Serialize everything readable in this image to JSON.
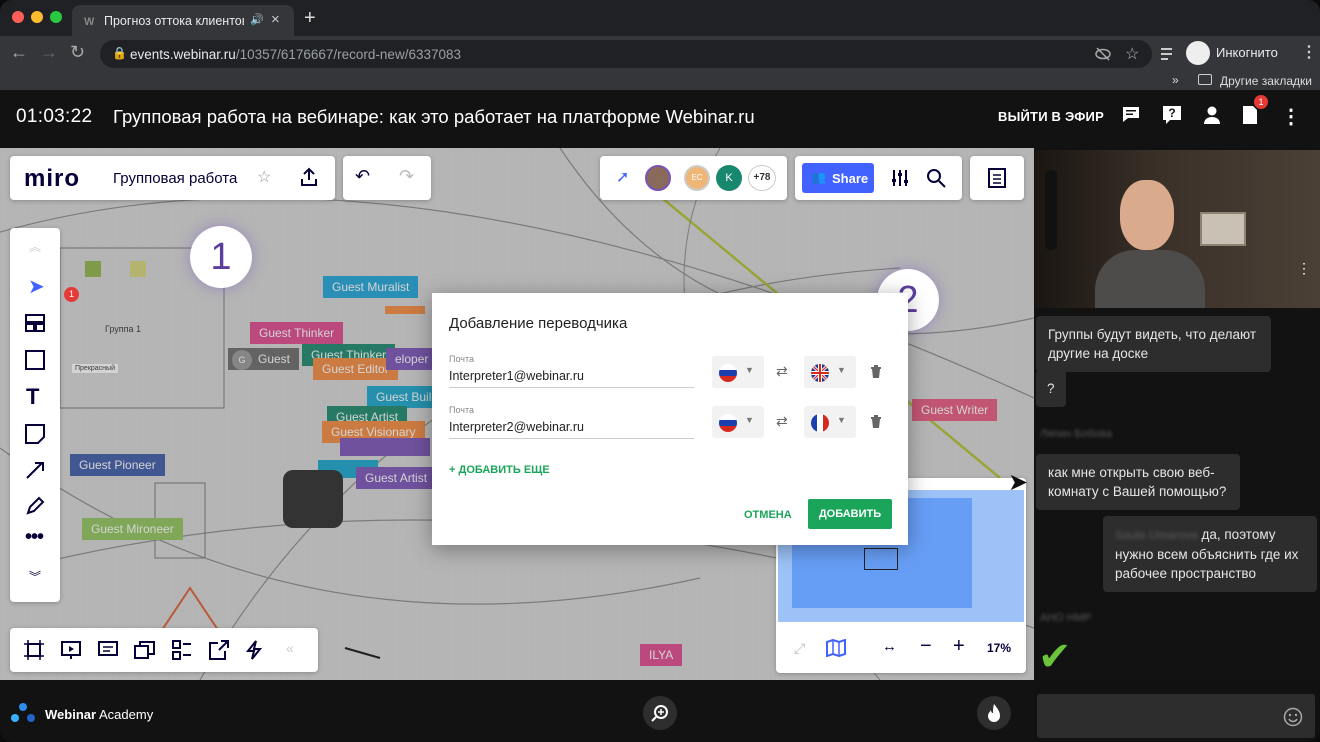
{
  "browser": {
    "tab_title": "Прогноз оттока клиентов",
    "tab_favicon": "W",
    "url_host": "events.webinar.ru",
    "url_path": "/10357/6176667/record-new/6337083",
    "profile_label": "Инкогнито",
    "bookmarks_label": "Другие закладки",
    "bookmarks_more": "»"
  },
  "header": {
    "timer": "01:03:22",
    "title": "Групповая работа на вебинаре: как это работает на платформе Webinar.ru",
    "go_live_label": "ВЫЙТИ В ЭФИР",
    "notification_badge": "1"
  },
  "miro": {
    "logo": "miro",
    "board_name": "Групповая работа",
    "share_label": "Share",
    "more_users": "+78",
    "avatar_initials": [
      "EC",
      "K"
    ],
    "zoom": "17%",
    "toolbar_badge": "1",
    "group_label": "Группа 1",
    "small_label": "Прекрасный"
  },
  "callouts": {
    "one": "1",
    "two": "2"
  },
  "board_tags": [
    {
      "label": "Guest Muralist",
      "color": "#1ea5d8"
    },
    {
      "label": "Guest Thinker",
      "color": "#e0478d"
    },
    {
      "label": "Guest Thinker",
      "color": "#17876d"
    },
    {
      "label": "Guest Editor",
      "color": "#f5883c"
    },
    {
      "label": "Guest",
      "color": "#6a6a6a"
    },
    {
      "label": "Guest Artist",
      "color": "#17876d"
    },
    {
      "label": "Guest Visionary",
      "color": "#f5883c"
    },
    {
      "label": "Guest Artist",
      "color": "#7a52b8"
    },
    {
      "label": "Guest Pioneer",
      "color": "#3d5aa8"
    },
    {
      "label": "Guest Mironeer",
      "color": "#8fc55a"
    },
    {
      "label": "Guest Writer",
      "color": "#e8587e"
    },
    {
      "label": "ILYA",
      "color": "#e0478d"
    },
    {
      "label": "Guest Build",
      "color": "#17a6cc"
    },
    {
      "label": "eloper",
      "color": "#7a52b8"
    }
  ],
  "dialog": {
    "title": "Добавление переводчика",
    "rows": [
      {
        "field_label": "Почта",
        "email": "Interpreter1@webinar.ru",
        "from_flag": "russia-flag",
        "to_flag": "uk-flag"
      },
      {
        "field_label": "Почта",
        "email": "Interpreter2@webinar.ru",
        "from_flag": "russia-flag",
        "to_flag": "france-flag"
      }
    ],
    "add_more": "+ ДОБАВИТЬ ЕЩЕ",
    "cancel": "ОТМЕНА",
    "submit": "ДОБАВИТЬ",
    "accent": "#1aa55b"
  },
  "chat": {
    "messages": [
      {
        "text": "Группы будут видеть, что делают другие на доске"
      },
      {
        "text": "?"
      },
      {
        "author_blurred": "Ляпин Бобова"
      },
      {
        "text": "как мне открыть свою веб-комнату с Вашей помощью?"
      },
      {
        "author_blurred": "Saule Umarova",
        "text": "да, поэтому нужно всем объяснить где их рабочее пространство"
      },
      {
        "author_blurred": "АНО НМР"
      }
    ],
    "checkmark": "✔"
  },
  "footer": {
    "brand": "Webinar",
    "brand_suffix": "Academy"
  }
}
